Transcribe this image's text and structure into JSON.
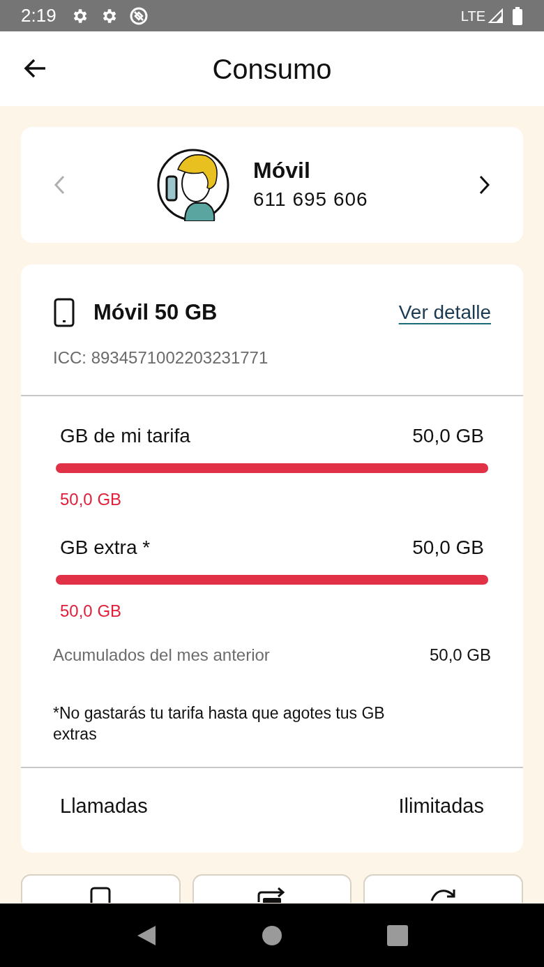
{
  "status_bar": {
    "time": "2:19",
    "network": "LTE"
  },
  "header": {
    "title": "Consumo"
  },
  "line_selector": {
    "name": "Móvil",
    "number": "611 695 606",
    "prev_disabled": true,
    "next_disabled": false
  },
  "plan": {
    "title": "Móvil 50 GB",
    "link": "Ver detalle",
    "icc": "ICC: 8934571002203231771",
    "meters": [
      {
        "label": "GB de mi tarifa",
        "total": "50,0 GB",
        "level": 1,
        "used": "50,0 GB"
      },
      {
        "label": "GB extra *",
        "total": "50,0 GB",
        "level": 1,
        "used": "50,0 GB"
      }
    ],
    "accumulated": {
      "label": "Acumulados del mes anterior",
      "value": "50,0 GB"
    },
    "note": "*No gastarás tu tarifa hasta que agotes tus GB extras",
    "calls": {
      "label": "Llamadas",
      "value": "Ilimitadas"
    }
  },
  "actions": [
    {
      "kind": "phone"
    },
    {
      "kind": "transfer"
    },
    {
      "kind": "renew"
    }
  ]
}
